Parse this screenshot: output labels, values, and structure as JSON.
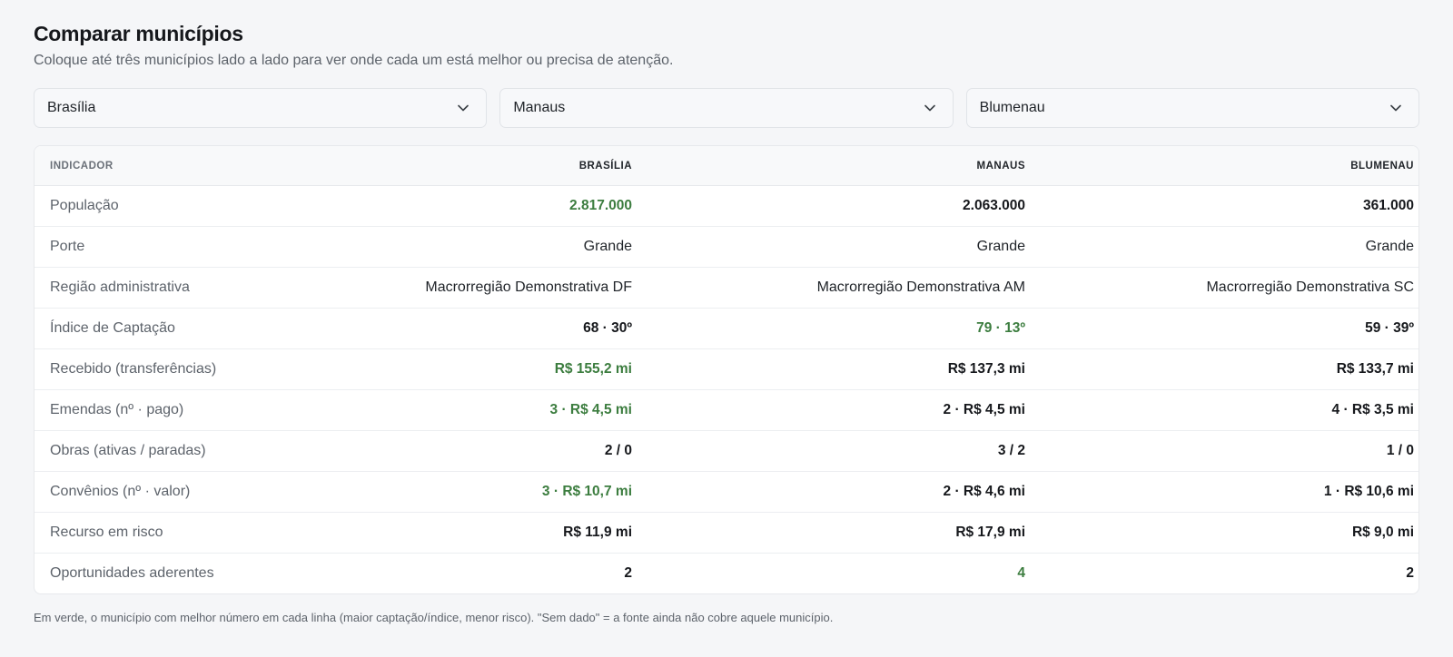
{
  "header": {
    "title": "Comparar municípios",
    "subtitle": "Coloque até três municípios lado a lado para ver onde cada um está melhor ou precisa de atenção."
  },
  "selectors": [
    {
      "value": "Brasília",
      "icon": "chevron-down-icon"
    },
    {
      "value": "Manaus",
      "icon": "chevron-down-icon"
    },
    {
      "value": "Blumenau",
      "icon": "chevron-down-icon"
    }
  ],
  "colors": {
    "best": "#3c7d3f",
    "background": "#f5f6f8"
  },
  "table": {
    "columns": [
      "Indicador",
      "Brasília",
      "Manaus",
      "Blumenau"
    ],
    "rows": [
      {
        "label": "População",
        "values": [
          "2.817.000",
          "2.063.000",
          "361.000"
        ],
        "best": 0,
        "plain": false
      },
      {
        "label": "Porte",
        "values": [
          "Grande",
          "Grande",
          "Grande"
        ],
        "best": null,
        "plain": true
      },
      {
        "label": "Região administrativa",
        "values": [
          "Macrorregião Demonstrativa DF",
          "Macrorregião Demonstrativa AM",
          "Macrorregião Demonstrativa SC"
        ],
        "best": null,
        "plain": true
      },
      {
        "label": "Índice de Captação",
        "values": [
          "68 · 30º",
          "79 · 13º",
          "59 · 39º"
        ],
        "best": 1,
        "plain": false
      },
      {
        "label": "Recebido (transferências)",
        "values": [
          "R$ 155,2 mi",
          "R$ 137,3 mi",
          "R$ 133,7 mi"
        ],
        "best": 0,
        "plain": false
      },
      {
        "label": "Emendas (nº · pago)",
        "values": [
          "3 · R$ 4,5 mi",
          "2 · R$ 4,5 mi",
          "4 · R$ 3,5 mi"
        ],
        "best": 0,
        "plain": false
      },
      {
        "label": "Obras (ativas / paradas)",
        "values": [
          "2 / 0",
          "3 / 2",
          "1 / 0"
        ],
        "best": null,
        "plain": false
      },
      {
        "label": "Convênios (nº · valor)",
        "values": [
          "3 · R$ 10,7 mi",
          "2 · R$ 4,6 mi",
          "1 · R$ 10,6 mi"
        ],
        "best": 0,
        "plain": false
      },
      {
        "label": "Recurso em risco",
        "values": [
          "R$ 11,9 mi",
          "R$ 17,9 mi",
          "R$ 9,0 mi"
        ],
        "best": null,
        "plain": false
      },
      {
        "label": "Oportunidades aderentes",
        "values": [
          "2",
          "4",
          "2"
        ],
        "best": 1,
        "plain": false
      }
    ]
  },
  "footnote": "Em verde, o município com melhor número em cada linha (maior captação/índice, menor risco). \"Sem dado\" = a fonte ainda não cobre aquele município."
}
